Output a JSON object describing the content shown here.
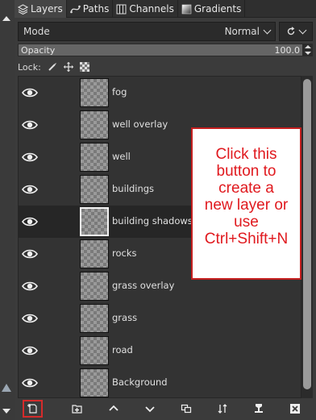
{
  "tabs": [
    {
      "label": "Layers",
      "icon": "layers-icon",
      "active": true
    },
    {
      "label": "Paths",
      "icon": "paths-icon",
      "active": false
    },
    {
      "label": "Channels",
      "icon": "channels-icon",
      "active": false
    },
    {
      "label": "Gradients",
      "icon": "gradients-icon",
      "active": false
    }
  ],
  "mode": {
    "label": "Mode",
    "value": "Normal"
  },
  "opacity": {
    "label": "Opacity",
    "value": "100.0"
  },
  "lock": {
    "label": "Lock:"
  },
  "layers": [
    {
      "name": "fog",
      "visible": true,
      "selected": false
    },
    {
      "name": "well overlay",
      "visible": true,
      "selected": false
    },
    {
      "name": "well",
      "visible": true,
      "selected": false
    },
    {
      "name": "buildings",
      "visible": true,
      "selected": false
    },
    {
      "name": "building shadows",
      "visible": true,
      "selected": true
    },
    {
      "name": "rocks",
      "visible": true,
      "selected": false
    },
    {
      "name": "grass overlay",
      "visible": true,
      "selected": false
    },
    {
      "name": "grass",
      "visible": true,
      "selected": false
    },
    {
      "name": "road",
      "visible": true,
      "selected": false
    },
    {
      "name": "Background",
      "visible": true,
      "selected": false
    }
  ],
  "toolbar": [
    {
      "name": "new-layer-button",
      "icon": "new-layer-icon"
    },
    {
      "name": "new-layer-group-button",
      "icon": "new-group-icon"
    },
    {
      "name": "raise-layer-button",
      "icon": "arrow-up-icon"
    },
    {
      "name": "lower-layer-button",
      "icon": "arrow-down-icon"
    },
    {
      "name": "duplicate-layer-button",
      "icon": "duplicate-icon"
    },
    {
      "name": "merge-layer-button",
      "icon": "merge-icon"
    },
    {
      "name": "anchor-layer-button",
      "icon": "anchor-icon"
    },
    {
      "name": "delete-layer-button",
      "icon": "delete-icon"
    }
  ],
  "callout": {
    "lines": [
      "Click this",
      "button to",
      "create a",
      "new layer or",
      "use",
      "Ctrl+Shift+N"
    ],
    "text_color": "#e0191e",
    "border_color": "#c51f1f"
  },
  "colors": {
    "highlight": "#d52b2b",
    "panel": "#333333",
    "selected_row": "#262626"
  }
}
